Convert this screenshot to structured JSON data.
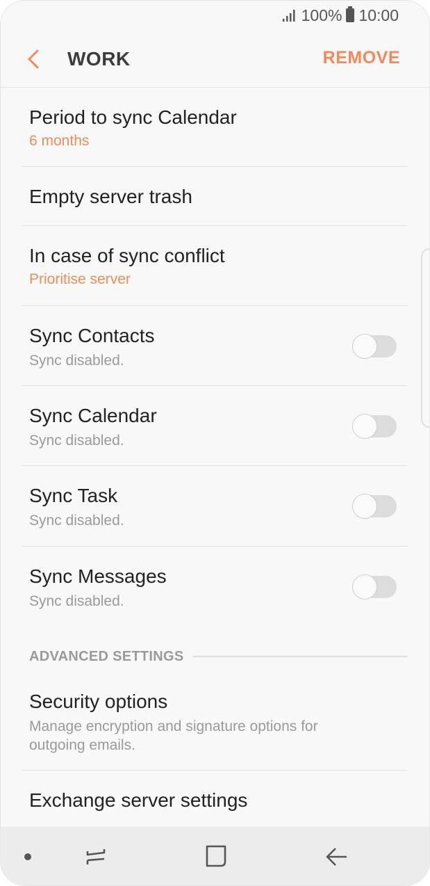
{
  "status_bar": {
    "battery": "100%",
    "time": "10:00"
  },
  "app_bar": {
    "title": "WORK",
    "action": "REMOVE"
  },
  "settings": [
    {
      "title": "Period to sync Calendar",
      "subtitle": "6 months"
    },
    {
      "title": "Empty server trash"
    },
    {
      "title": "In case of sync conflict",
      "subtitle": "Prioritise server"
    },
    {
      "title": "Sync Contacts",
      "subtitle": "Sync disabled.",
      "enabled": false
    },
    {
      "title": "Sync Calendar",
      "subtitle": "Sync disabled.",
      "enabled": false
    },
    {
      "title": "Sync Task",
      "subtitle": "Sync disabled.",
      "enabled": false
    },
    {
      "title": "Sync Messages",
      "subtitle": "Sync disabled.",
      "enabled": false
    }
  ],
  "advanced": {
    "header": "ADVANCED SETTINGS",
    "items": [
      {
        "title": "Security options",
        "subtitle_line1": "Manage encryption and signature options for",
        "subtitle_line2": "outgoing emails."
      },
      {
        "title": "Exchange server settings"
      }
    ]
  },
  "colors": {
    "accent": "#f18a5a",
    "subtitle_accent": "#ee8c5c",
    "subtitle_gray": "#9a9a9a",
    "background": "#f8f8f8"
  },
  "icons": [
    "signal-icon",
    "battery-icon",
    "back-arrow-icon",
    "recents-icon",
    "home-icon",
    "back-icon"
  ]
}
